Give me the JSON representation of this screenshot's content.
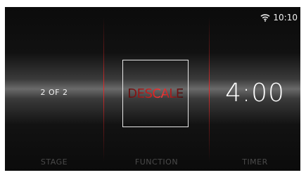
{
  "status_bar": {
    "wifi_icon": "wifi-icon",
    "time": "10:10"
  },
  "stage": {
    "value": "2 OF 2",
    "label": "STAGE"
  },
  "function": {
    "value": "DESCALE",
    "label": "FUNCTION"
  },
  "timer": {
    "value": "4:00",
    "label": "TIMER"
  },
  "colors": {
    "accent": "#e02828",
    "text": "#ffffff",
    "label": "#4a4a4a"
  }
}
